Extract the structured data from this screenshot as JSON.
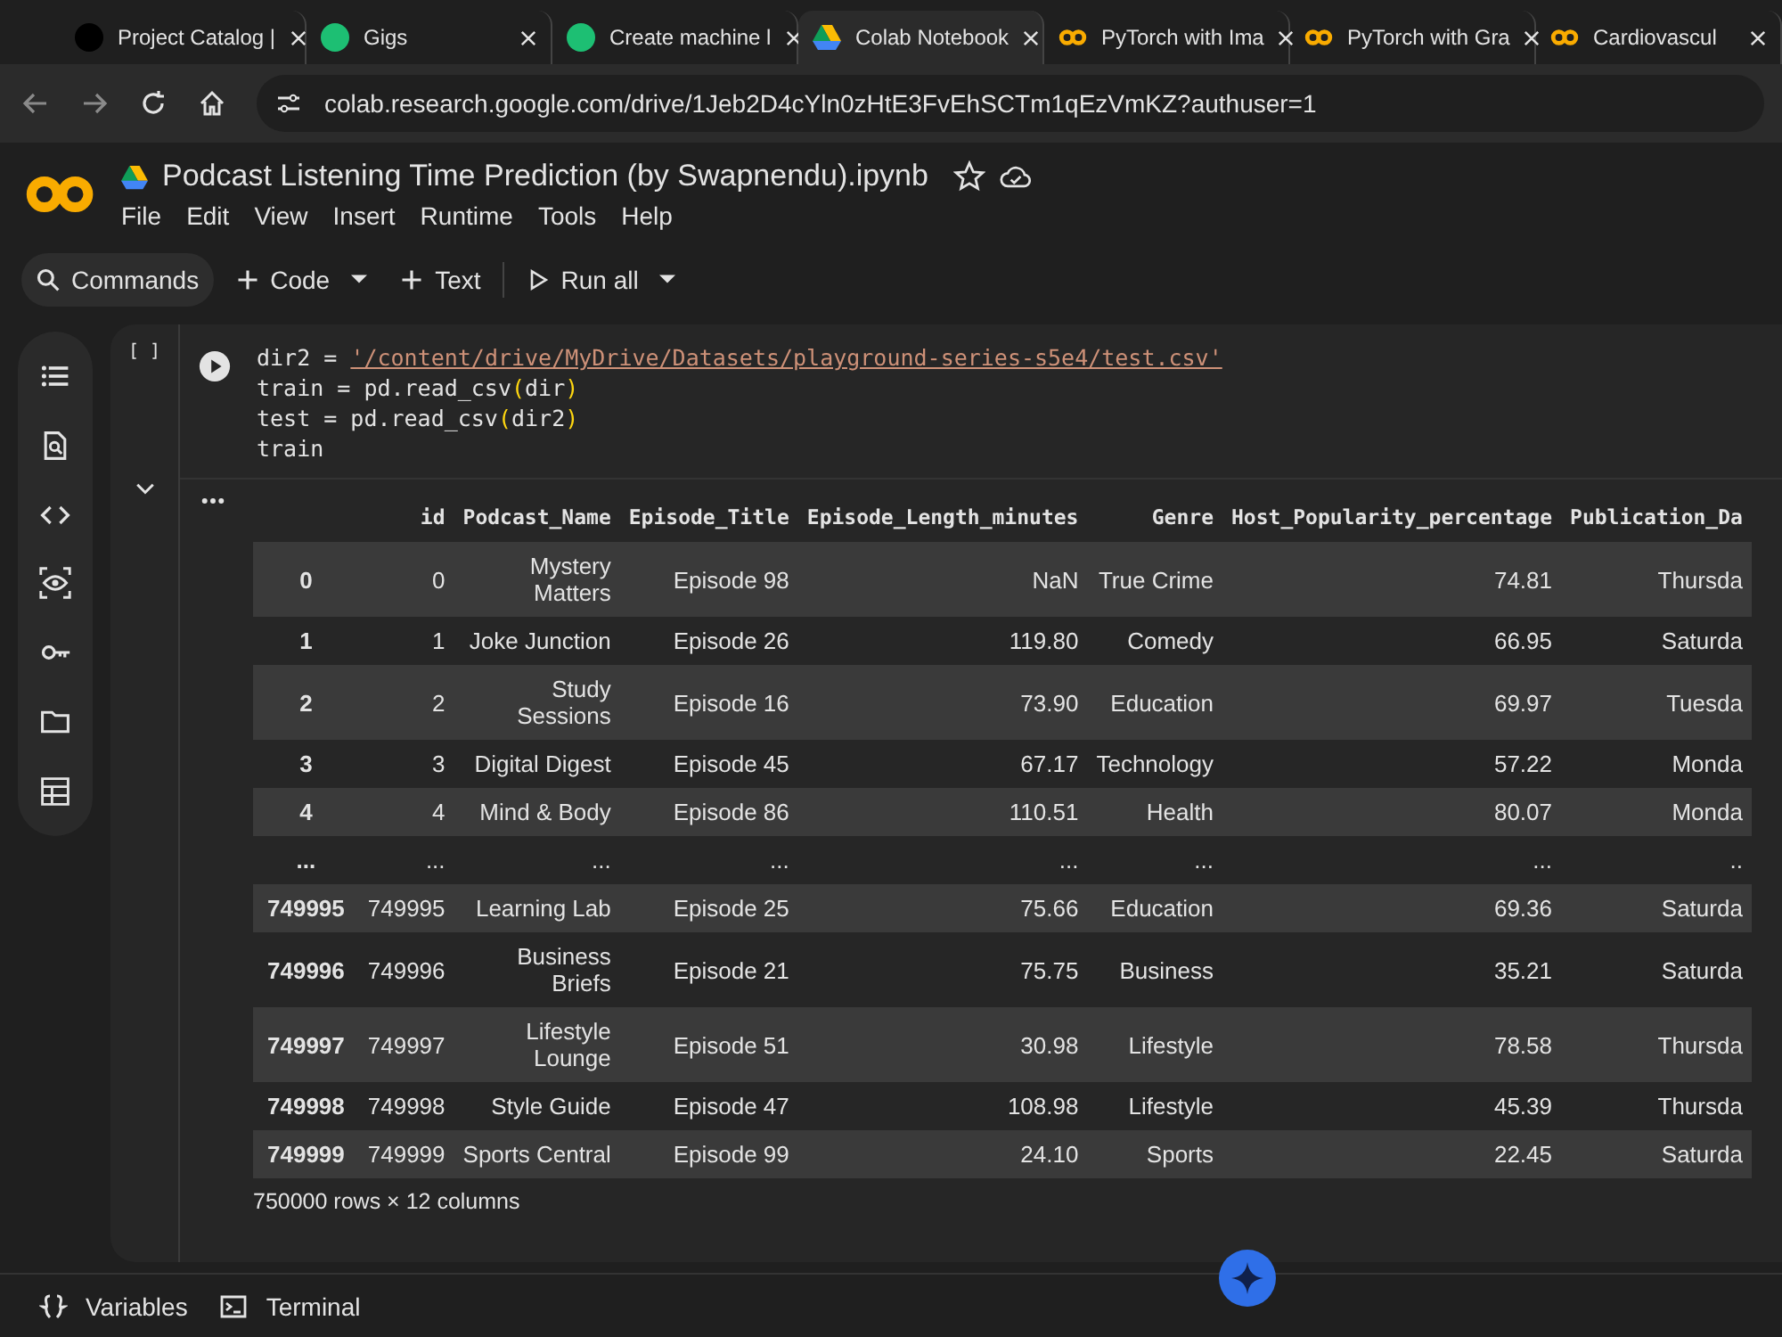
{
  "browser": {
    "tabs": [
      {
        "title": "Project Catalog |",
        "kind": "dark",
        "selected": false
      },
      {
        "title": "Gigs",
        "kind": "green",
        "selected": false
      },
      {
        "title": "Create machine l",
        "kind": "green",
        "selected": false
      },
      {
        "title": "Colab Notebook",
        "kind": "drive",
        "selected": true
      },
      {
        "title": "PyTorch with Ima",
        "kind": "colab",
        "selected": false
      },
      {
        "title": "PyTorch with Gra",
        "kind": "colab",
        "selected": false
      },
      {
        "title": "Cardiovascul",
        "kind": "colab",
        "selected": false
      }
    ],
    "address": "colab.research.google.com/drive/1Jeb2D4cYln0zHtE3FvEhSCTm1qEzVmKZ?authuser=1"
  },
  "notebook": {
    "title": "Podcast Listening Time Prediction (by Swapnendu).ipynb",
    "menu": [
      "File",
      "Edit",
      "View",
      "Insert",
      "Runtime",
      "Tools",
      "Help"
    ]
  },
  "toolbar": {
    "commands": "Commands",
    "code": "Code",
    "text": "Text",
    "run_all": "Run all"
  },
  "cell": {
    "prompt": "[ ]",
    "code": [
      [
        {
          "t": "dir2 = ",
          "kind": "plain"
        },
        {
          "t": "'/content/drive/MyDrive/Datasets/playground-series-s5e4/test.csv'",
          "kind": "string"
        }
      ],
      [
        {
          "t": "train = pd.read_csv",
          "kind": "plain"
        },
        {
          "t": "(",
          "kind": "paren"
        },
        {
          "t": "dir",
          "kind": "plain"
        },
        {
          "t": ")",
          "kind": "paren"
        }
      ],
      [
        {
          "t": "test = pd.read_csv",
          "kind": "plain"
        },
        {
          "t": "(",
          "kind": "paren"
        },
        {
          "t": "dir2",
          "kind": "plain"
        },
        {
          "t": ")",
          "kind": "paren"
        }
      ],
      [
        {
          "t": "train",
          "kind": "plain"
        }
      ]
    ]
  },
  "output": {
    "columns": [
      "id",
      "Podcast_Name",
      "Episode_Title",
      "Episode_Length_minutes",
      "Genre",
      "Host_Popularity_percentage",
      "Publication_Da"
    ],
    "rows": [
      {
        "index": "0",
        "cells": [
          "0",
          "Mystery\nMatters",
          "Episode 98",
          "NaN",
          "True Crime",
          "74.81",
          "Thursda"
        ]
      },
      {
        "index": "1",
        "cells": [
          "1",
          "Joke Junction",
          "Episode 26",
          "119.80",
          "Comedy",
          "66.95",
          "Saturda"
        ]
      },
      {
        "index": "2",
        "cells": [
          "2",
          "Study\nSessions",
          "Episode 16",
          "73.90",
          "Education",
          "69.97",
          "Tuesda"
        ]
      },
      {
        "index": "3",
        "cells": [
          "3",
          "Digital Digest",
          "Episode 45",
          "67.17",
          "Technology",
          "57.22",
          "Monda"
        ]
      },
      {
        "index": "4",
        "cells": [
          "4",
          "Mind & Body",
          "Episode 86",
          "110.51",
          "Health",
          "80.07",
          "Monda"
        ]
      },
      {
        "index": "...",
        "cells": [
          "...",
          "...",
          "...",
          "...",
          "...",
          "...",
          ".."
        ]
      },
      {
        "index": "749995",
        "cells": [
          "749995",
          "Learning Lab",
          "Episode 25",
          "75.66",
          "Education",
          "69.36",
          "Saturda"
        ]
      },
      {
        "index": "749996",
        "cells": [
          "749996",
          "Business\nBriefs",
          "Episode 21",
          "75.75",
          "Business",
          "35.21",
          "Saturda"
        ]
      },
      {
        "index": "749997",
        "cells": [
          "749997",
          "Lifestyle\nLounge",
          "Episode 51",
          "30.98",
          "Lifestyle",
          "78.58",
          "Thursda"
        ]
      },
      {
        "index": "749998",
        "cells": [
          "749998",
          "Style Guide",
          "Episode 47",
          "108.98",
          "Lifestyle",
          "45.39",
          "Thursda"
        ]
      },
      {
        "index": "749999",
        "cells": [
          "749999",
          "Sports Central",
          "Episode 99",
          "24.10",
          "Sports",
          "22.45",
          "Saturda"
        ]
      }
    ],
    "summary": "750000 rows × 12 columns"
  },
  "bottom": {
    "variables": "Variables",
    "terminal": "Terminal"
  }
}
